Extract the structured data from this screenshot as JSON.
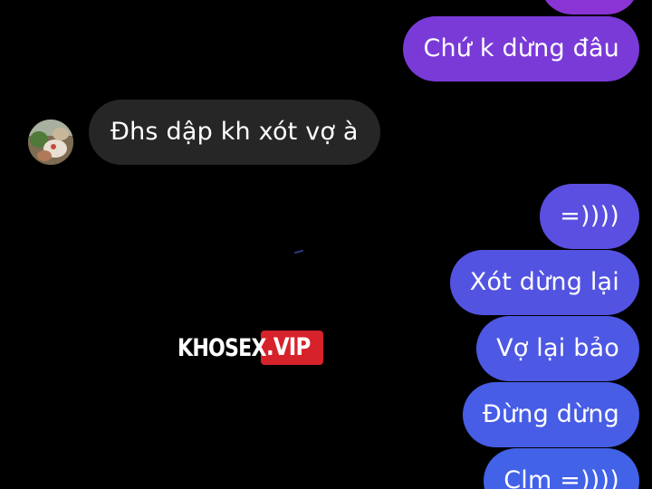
{
  "thread": {
    "messages": [
      {
        "side": "sent",
        "text": "",
        "color": "#8a34d6"
      },
      {
        "side": "sent",
        "text": "Chứ k dừng đâu",
        "color": "#7a3ad8"
      },
      {
        "side": "received",
        "text": "Đhs dập kh xót vợ à",
        "color": "#262626"
      },
      {
        "side": "sent",
        "text": "=))))",
        "color": "#5a4fe0"
      },
      {
        "side": "sent",
        "text": "Xót dừng lại",
        "color": "#5353e2"
      },
      {
        "side": "sent",
        "text": "Vợ lại bảo",
        "color": "#4d58e4"
      },
      {
        "side": "sent",
        "text": "Đừng dừng",
        "color": "#475de6"
      },
      {
        "side": "sent",
        "text": "Clm =))))",
        "color": "#4262e8"
      }
    ]
  },
  "watermark": {
    "main": "KHOSEX",
    "suffix": ".VIP"
  }
}
